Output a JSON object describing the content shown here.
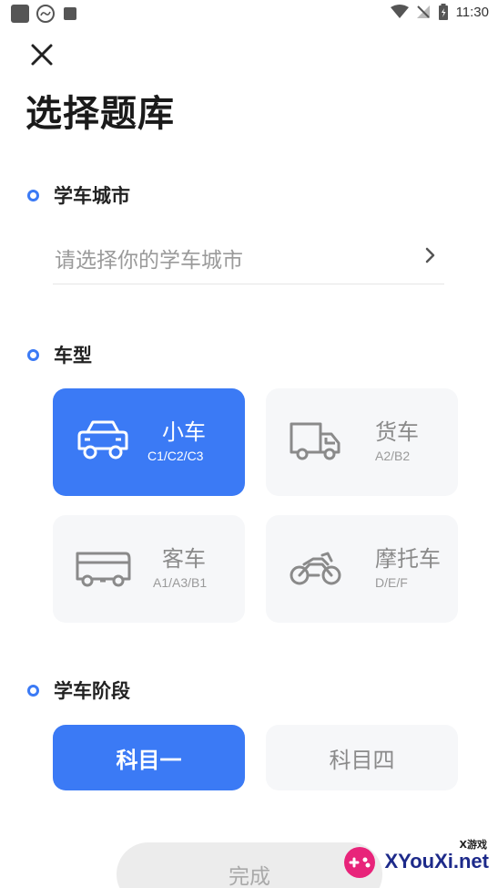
{
  "status_bar": {
    "time": "11:30"
  },
  "title": "选择题库",
  "city_section": {
    "title": "学车城市",
    "placeholder": "请选择你的学车城市"
  },
  "vehicle_section": {
    "title": "车型",
    "cards": [
      {
        "name": "小车",
        "classes": "C1/C2/C3",
        "icon": "car-icon",
        "selected": true
      },
      {
        "name": "货车",
        "classes": "A2/B2",
        "icon": "truck-icon",
        "selected": false
      },
      {
        "name": "客车",
        "classes": "A1/A3/B1",
        "icon": "bus-icon",
        "selected": false
      },
      {
        "name": "摩托车",
        "classes": "D/E/F",
        "icon": "motorcycle-icon",
        "selected": false
      }
    ]
  },
  "stage_section": {
    "title": "学车阶段",
    "options": [
      {
        "label": "科目一",
        "selected": true
      },
      {
        "label": "科目四",
        "selected": false
      }
    ]
  },
  "done_label": "完成",
  "watermark": {
    "brand": "XYouXi.net",
    "tag": "X游戏"
  },
  "colors": {
    "accent": "#3b7af5",
    "card_bg": "#f6f7f9"
  }
}
